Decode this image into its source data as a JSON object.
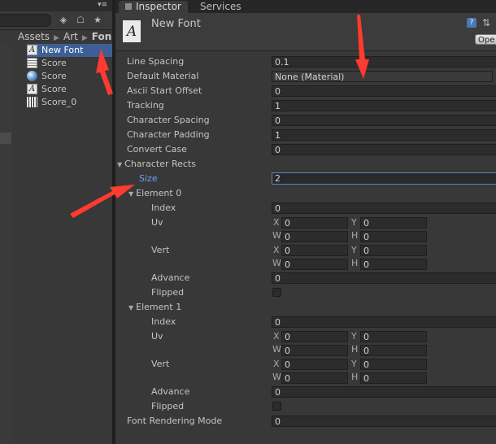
{
  "project": {
    "breadcrumb": [
      "Assets",
      "Art",
      "Fon"
    ],
    "assets": [
      {
        "label": "New Font",
        "icon": "font-icon",
        "selected": true
      },
      {
        "label": "Score",
        "icon": "text-asset-icon",
        "selected": false
      },
      {
        "label": "Score",
        "icon": "material-sphere-icon",
        "selected": false
      },
      {
        "label": "Score",
        "icon": "font-icon",
        "selected": false
      },
      {
        "label": "Score_0",
        "icon": "texture-icon",
        "selected": false
      }
    ],
    "toolbar_icons": [
      "filter-by-type-icon",
      "filter-by-label-icon",
      "favorite-star-icon"
    ],
    "menu_glyph": "▾≡"
  },
  "inspector": {
    "tabs": [
      {
        "label": "Inspector",
        "active": true
      },
      {
        "label": "Services",
        "active": false
      }
    ],
    "title": "New Font",
    "header_icon_glyph": "A",
    "open_button": "Ope",
    "help_glyph": "?",
    "settings_glyph": "⇅",
    "properties": [
      {
        "label": "Line Spacing",
        "value": "0.1"
      },
      {
        "label": "Default Material",
        "value": "None (Material)"
      },
      {
        "label": "Ascii Start Offset",
        "value": "0"
      },
      {
        "label": "Tracking",
        "value": "1"
      },
      {
        "label": "Character Spacing",
        "value": "0"
      },
      {
        "label": "Character Padding",
        "value": "1"
      },
      {
        "label": "Convert Case",
        "value": "0"
      }
    ],
    "character_rects": {
      "label": "Character Rects",
      "size_label": "Size",
      "size_value": "2",
      "elements": [
        {
          "label": "Element 0",
          "index_label": "Index",
          "index": "0",
          "uv_label": "Uv",
          "uv": {
            "x": "0",
            "y": "0",
            "w": "0",
            "h": "0"
          },
          "vert_label": "Vert",
          "vert": {
            "x": "0",
            "y": "0",
            "w": "0",
            "h": "0"
          },
          "advance_label": "Advance",
          "advance": "0",
          "flipped_label": "Flipped",
          "flipped": false
        },
        {
          "label": "Element 1",
          "index_label": "Index",
          "index": "0",
          "uv_label": "Uv",
          "uv": {
            "x": "0",
            "y": "0",
            "w": "0",
            "h": "0"
          },
          "vert_label": "Vert",
          "vert": {
            "x": "0",
            "y": "0",
            "w": "0",
            "h": "0"
          },
          "advance_label": "Advance",
          "advance": "0",
          "flipped_label": "Flipped",
          "flipped": false
        }
      ]
    },
    "font_rendering_mode": {
      "label": "Font Rendering Mode",
      "value": "0"
    },
    "axis_letters": {
      "x": "X",
      "y": "Y",
      "w": "W",
      "h": "H"
    }
  },
  "colors": {
    "panel": "#383838",
    "selection": "#3e5f96",
    "focus_border": "#5883c9",
    "active_label": "#6f9dff",
    "annotation_arrow": "#ff3a2e"
  }
}
